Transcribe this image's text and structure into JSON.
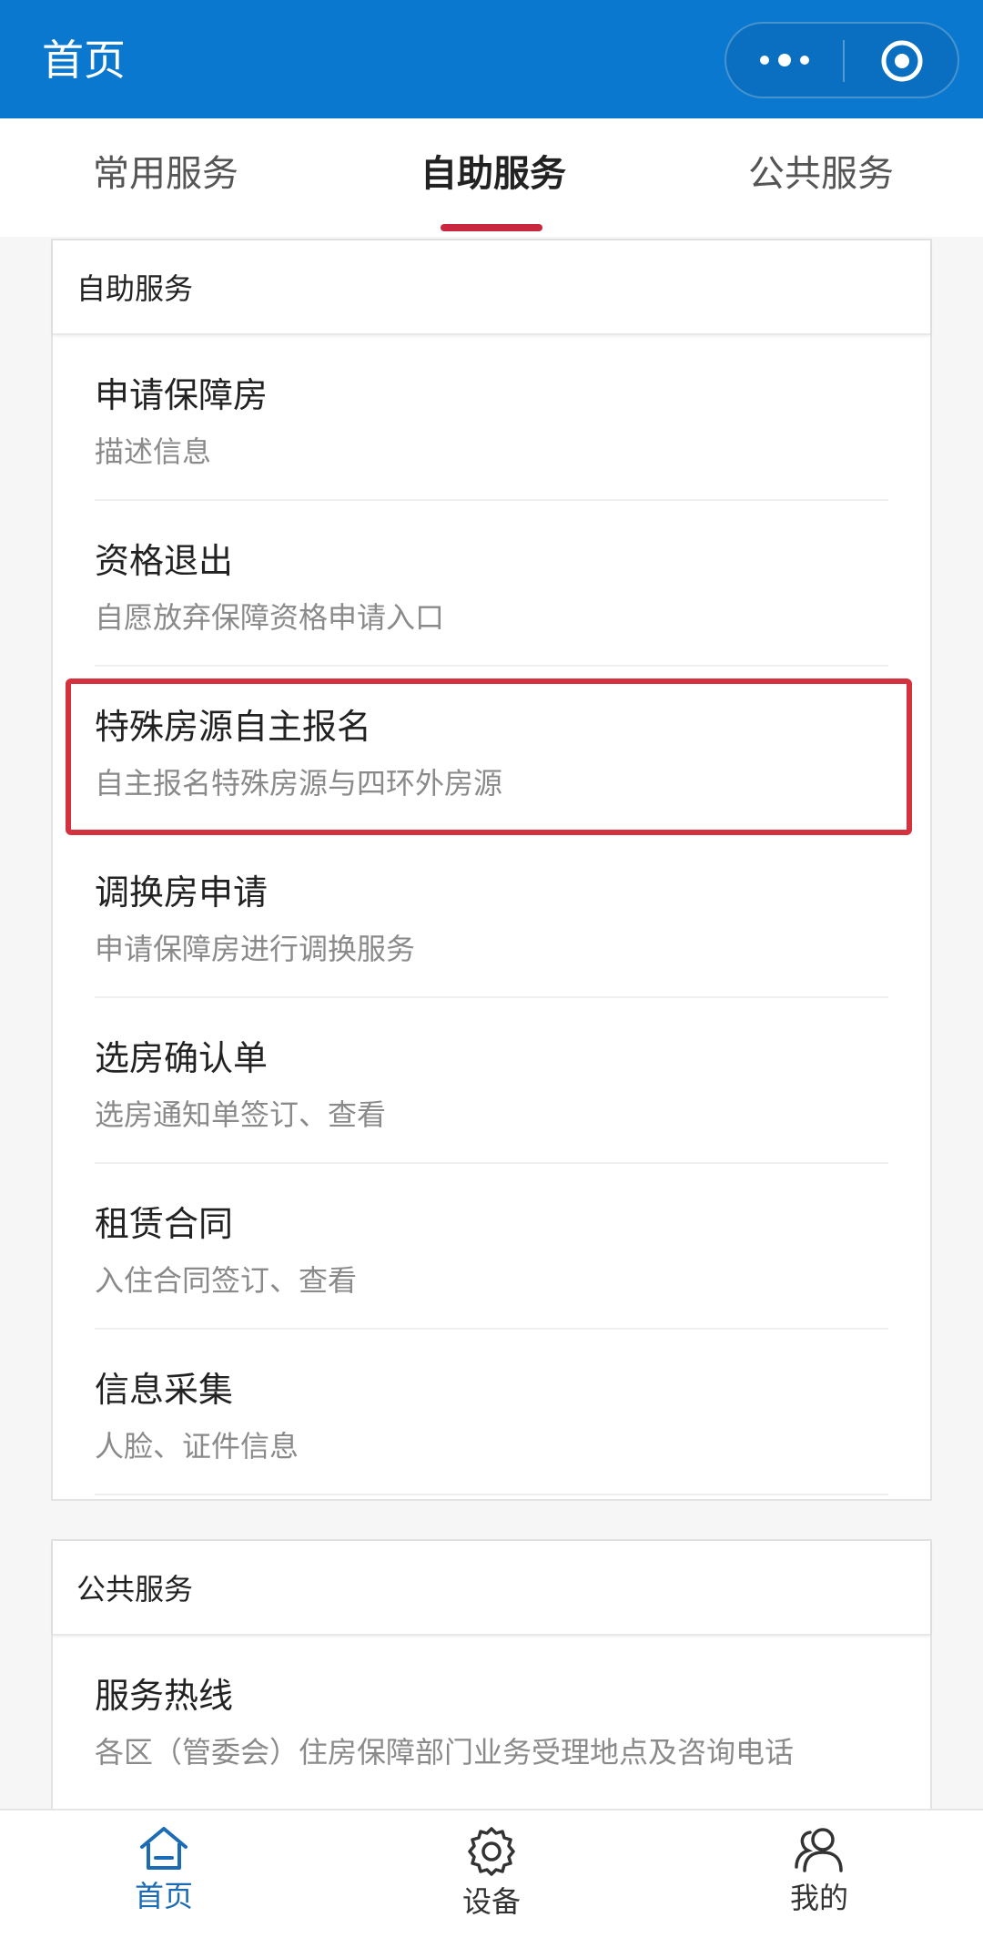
{
  "header": {
    "title": "首页"
  },
  "tabs": [
    {
      "label": "常用服务",
      "active": false
    },
    {
      "label": "自助服务",
      "active": true
    },
    {
      "label": "公共服务",
      "active": false
    }
  ],
  "self_service": {
    "header": "自助服务",
    "items": [
      {
        "title": "申请保障房",
        "desc": "描述信息"
      },
      {
        "title": "资格退出",
        "desc": "自愿放弃保障资格申请入口"
      },
      {
        "title": "特殊房源自主报名",
        "desc": "自主报名特殊房源与四环外房源"
      },
      {
        "title": "调换房申请",
        "desc": "申请保障房进行调换服务"
      },
      {
        "title": "选房确认单",
        "desc": "选房通知单签订、查看"
      },
      {
        "title": "租赁合同",
        "desc": "入住合同签订、查看"
      },
      {
        "title": "信息采集",
        "desc": "人脸、证件信息"
      }
    ]
  },
  "public_service": {
    "header": "公共服务",
    "items": [
      {
        "title": "服务热线",
        "desc": "各区（管委会）住房保障部门业务受理地点及咨询电话"
      }
    ]
  },
  "bottom_nav": [
    {
      "label": "首页",
      "icon": "home-icon",
      "active": true
    },
    {
      "label": "设备",
      "icon": "gear-icon",
      "active": false
    },
    {
      "label": "我的",
      "icon": "users-icon",
      "active": false
    }
  ],
  "colors": {
    "brand": "#0b78cf",
    "accent": "#c8273f",
    "nav_active": "#1b6bb5"
  }
}
